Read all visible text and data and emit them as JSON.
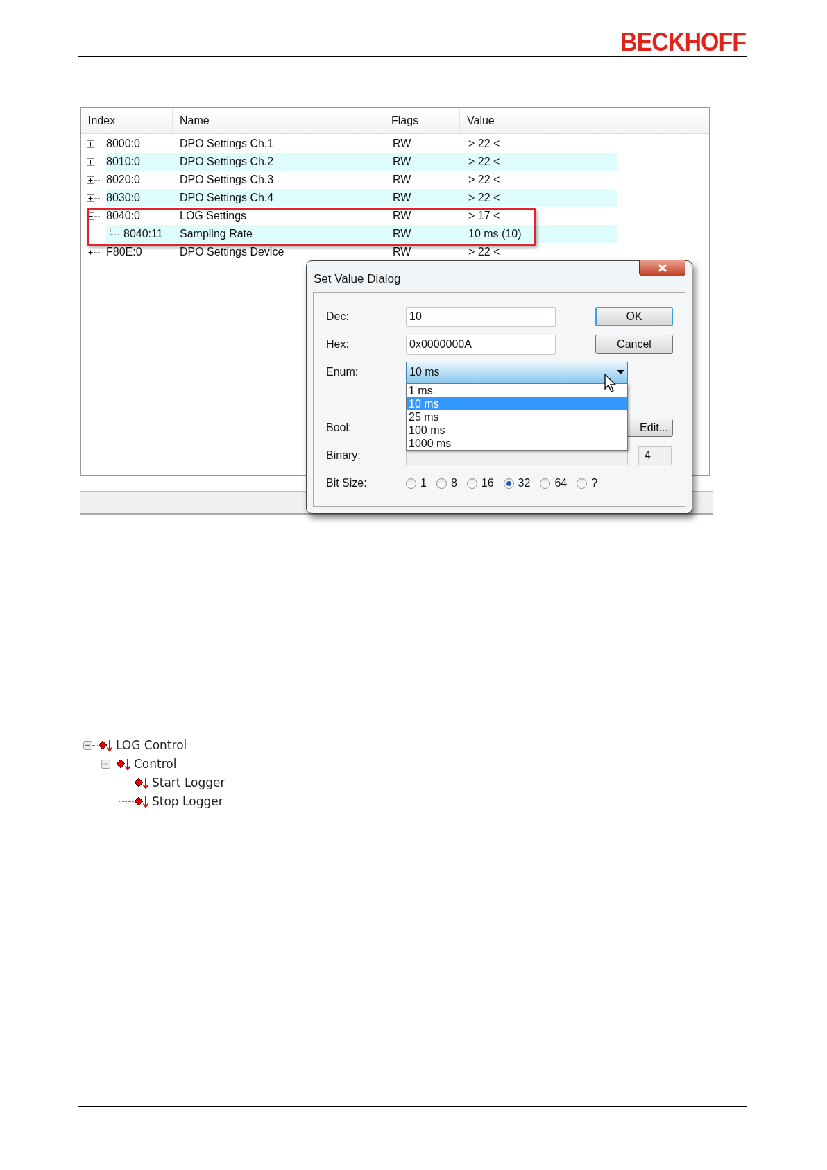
{
  "header": {
    "logo": "BECKHOFF"
  },
  "object_table": {
    "columns": [
      "Index",
      "Name",
      "Flags",
      "Value"
    ],
    "rows": [
      {
        "index": "8000:0",
        "name": "DPO Settings Ch.1",
        "flags": "RW",
        "value": "> 22 <",
        "expanded": false,
        "framed": false
      },
      {
        "index": "8010:0",
        "name": "DPO Settings Ch.2",
        "flags": "RW",
        "value": "> 22 <",
        "expanded": false,
        "framed": false
      },
      {
        "index": "8020:0",
        "name": "DPO Settings Ch.3",
        "flags": "RW",
        "value": "> 22 <",
        "expanded": false,
        "framed": false
      },
      {
        "index": "8030:0",
        "name": "DPO Settings Ch.4",
        "flags": "RW",
        "value": "> 22 <",
        "expanded": false,
        "framed": false
      },
      {
        "index": "8040:0",
        "name": "LOG Settings",
        "flags": "RW",
        "value": "> 17 <",
        "expanded": true,
        "framed": true,
        "children": [
          {
            "index": "8040:11",
            "name": "Sampling Rate",
            "flags": "RW",
            "value": "10 ms (10)"
          }
        ]
      },
      {
        "index": "F80E:0",
        "name": "DPO Settings Device",
        "flags": "RW",
        "value": "> 22 <",
        "expanded": false,
        "framed": false
      }
    ]
  },
  "dialog": {
    "title": "Set Value Dialog",
    "dec": {
      "label": "Dec:",
      "value": "10"
    },
    "hex": {
      "label": "Hex:",
      "value": "0x0000000A"
    },
    "enum": {
      "label": "Enum:",
      "value": "10 ms",
      "expanded": true,
      "options": [
        {
          "label": "1 ms",
          "selected": false
        },
        {
          "label": "10 ms",
          "selected": true
        },
        {
          "label": "25 ms",
          "selected": false
        },
        {
          "label": "100 ms",
          "selected": false
        },
        {
          "label": "1000 ms",
          "selected": false
        }
      ]
    },
    "bool": {
      "label": "Bool:",
      "button": "Edit..."
    },
    "binary": {
      "label": "Binary:",
      "size": "4"
    },
    "bit_size": {
      "label": "Bit Size:",
      "options": [
        {
          "label": "1",
          "selected": false
        },
        {
          "label": "8",
          "selected": false
        },
        {
          "label": "16",
          "selected": false
        },
        {
          "label": "32",
          "selected": true
        },
        {
          "label": "64",
          "selected": false
        },
        {
          "label": "?",
          "selected": false
        }
      ]
    },
    "buttons": [
      {
        "label": "OK",
        "default": true
      },
      {
        "label": "Cancel",
        "default": false
      }
    ]
  },
  "tree": [
    {
      "label": "LOG Control",
      "expanded": true,
      "children": [
        {
          "label": "Control",
          "expanded": true,
          "children": [
            {
              "label": "Start Logger"
            },
            {
              "label": "Stop Logger"
            }
          ]
        }
      ]
    }
  ]
}
